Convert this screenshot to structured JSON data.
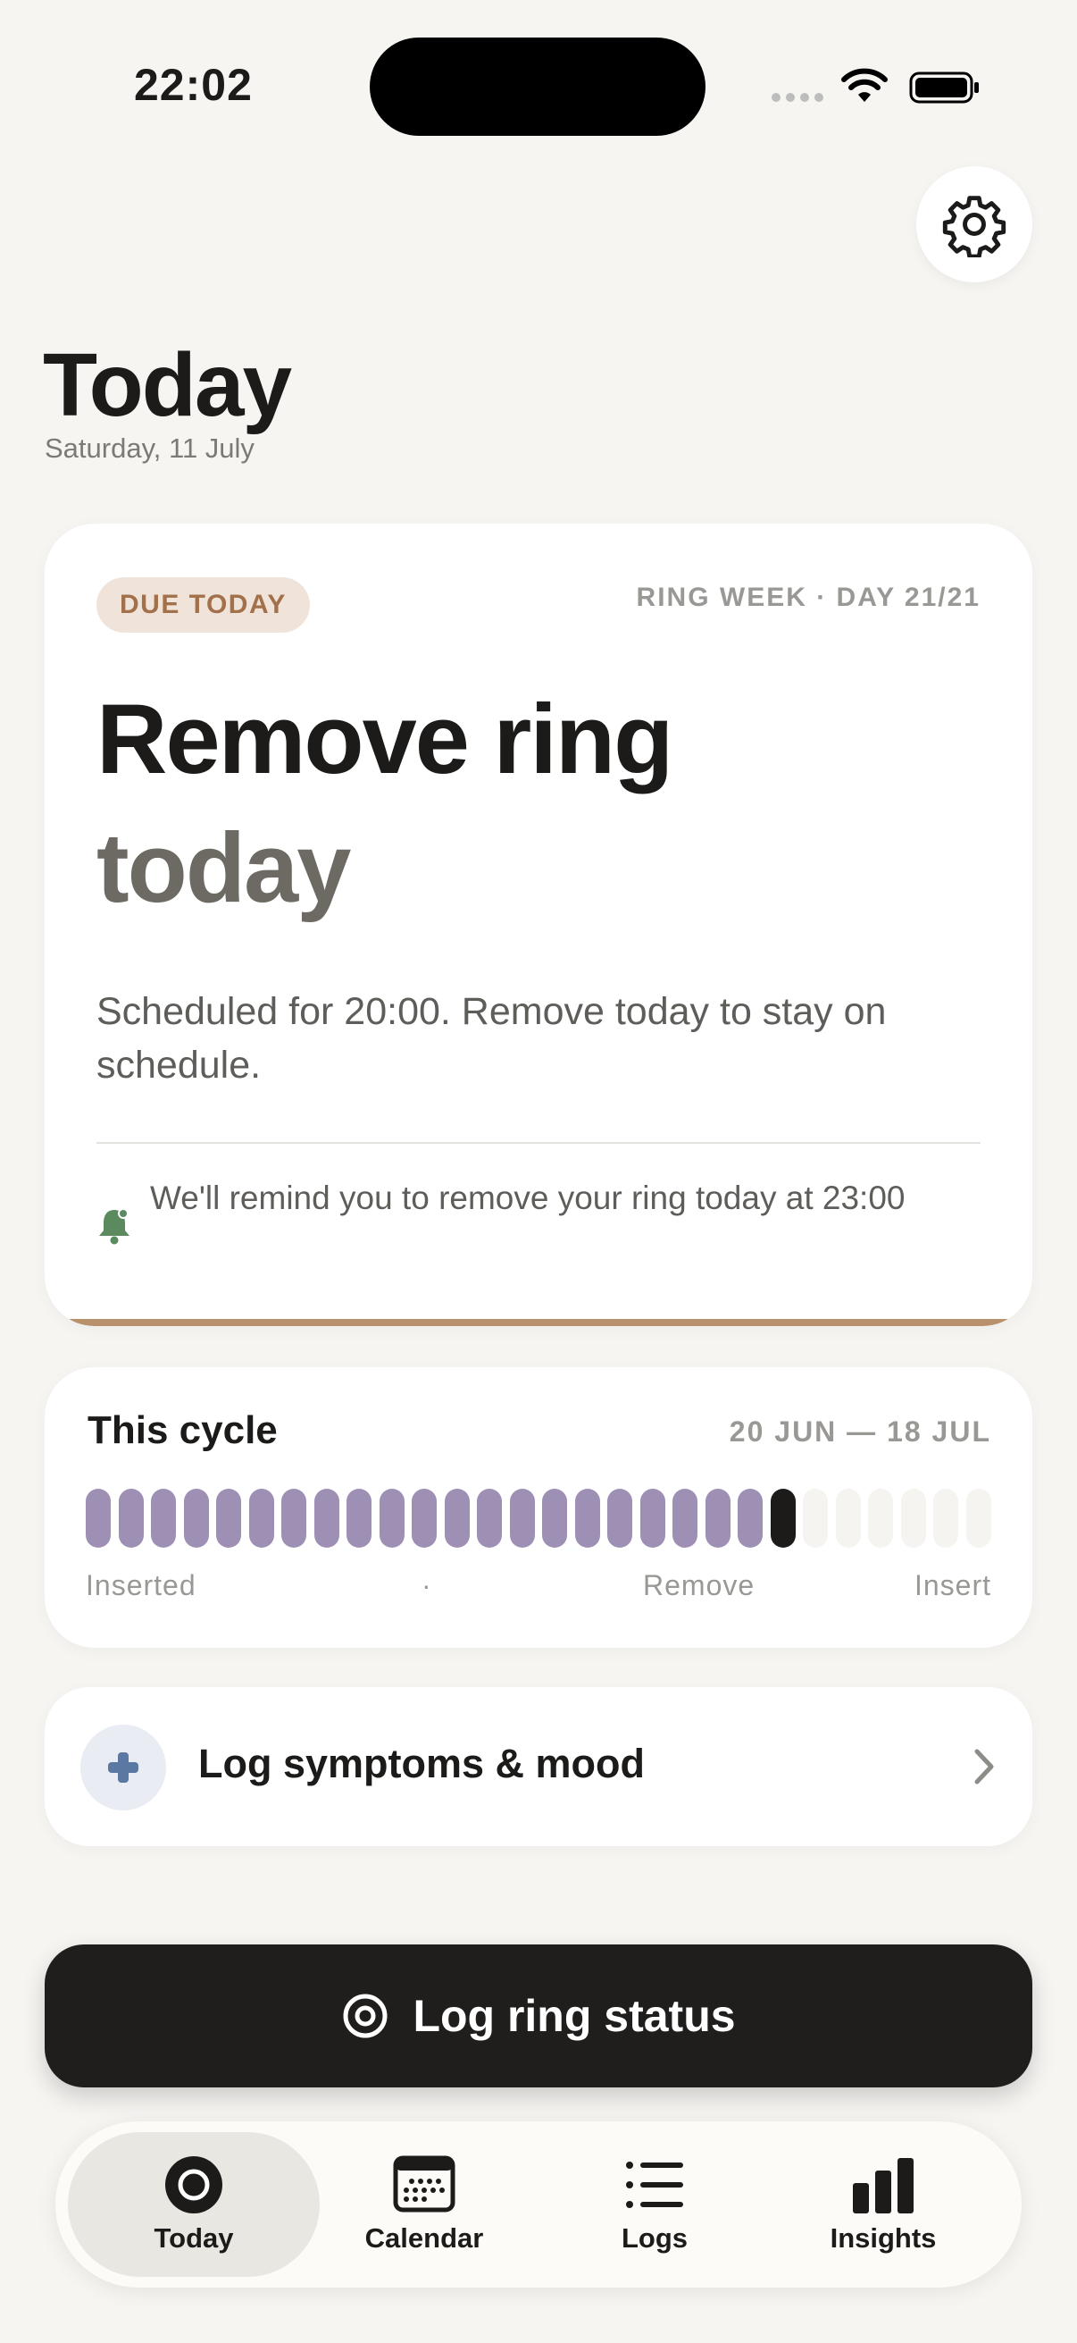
{
  "status_bar": {
    "time": "22:02"
  },
  "header": {
    "title": "Today",
    "date": "Saturday, 11 July"
  },
  "reminder_card": {
    "badge": "DUE TODAY",
    "ring_week": "RING WEEK · DAY 21/21",
    "headline_line1": "Remove ring",
    "headline_line2": "today",
    "description": "Scheduled for 20:00. Remove today to stay on schedule.",
    "reminder_text": "We'll remind you to remove your ring today at 23:00"
  },
  "cycle": {
    "title": "This cycle",
    "range": "20 JUN — 18 JUL",
    "segments_total": 28,
    "segments_past": 21,
    "current_day": 22,
    "labels": {
      "inserted": "Inserted",
      "dot": "·",
      "remove": "Remove",
      "insert": "Insert"
    }
  },
  "symptoms": {
    "label": "Log symptoms & mood"
  },
  "primary_action": {
    "label": "Log ring status"
  },
  "tabs": [
    {
      "label": "Today",
      "icon": "ring-icon",
      "active": true
    },
    {
      "label": "Calendar",
      "icon": "calendar-icon",
      "active": false
    },
    {
      "label": "Logs",
      "icon": "list-icon",
      "active": false
    },
    {
      "label": "Insights",
      "icon": "bar-chart-icon",
      "active": false
    }
  ],
  "colors": {
    "background": "#f6f5f2",
    "past_segment": "#9e8fb5",
    "current_segment": "#1c1b19",
    "badge_bg": "#f0e4da",
    "badge_text": "#a2704a",
    "bell": "#5a8a5e",
    "plus": "#5b78a3"
  }
}
